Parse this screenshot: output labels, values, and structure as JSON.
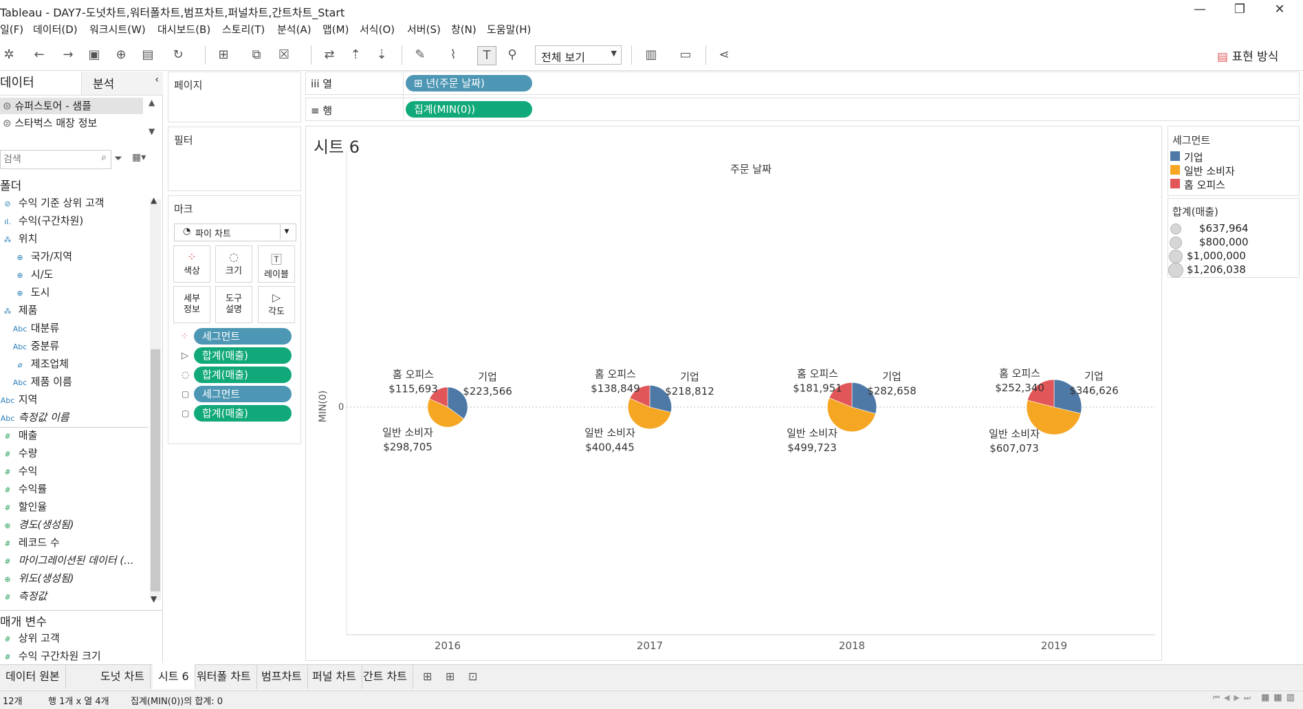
{
  "window": {
    "title": "Tableau - DAY7-도넛차트,워터폴차트,범프차트,퍼널차트,간트차트_Start"
  },
  "menu": [
    "일(F)",
    "데이터(D)",
    "워크시트(W)",
    "대시보드(B)",
    "스토리(T)",
    "분석(A)",
    "맵(M)",
    "서식(O)",
    "서버(S)",
    "창(N)",
    "도움말(H)"
  ],
  "toolbar": {
    "view_select": "전체 보기",
    "show_me": "표현 방식"
  },
  "datapane": {
    "tab_data": "데이터",
    "tab_analysis": "분석",
    "sources": [
      "슈퍼스토어 - 샘플",
      "스타벅스 매장 정보"
    ],
    "search_placeholder": "검색",
    "folder_header": "폴더",
    "fields": [
      {
        "label": "수익 기준 상위 고객",
        "icon": "set-icon"
      },
      {
        "label": "수익(구간차원)",
        "icon": "bin-icon"
      },
      {
        "label": "위치",
        "icon": "hierarchy-icon"
      },
      {
        "label": "국가/지역",
        "icon": "globe-icon"
      },
      {
        "label": "시/도",
        "icon": "globe-icon"
      },
      {
        "label": "도시",
        "icon": "globe-icon"
      },
      {
        "label": "제품",
        "icon": "hierarchy-icon"
      },
      {
        "label": "대분류",
        "icon": "abc-icon"
      },
      {
        "label": "중분류",
        "icon": "abc-icon"
      },
      {
        "label": "제조업체",
        "icon": "paperclip-icon"
      },
      {
        "label": "제품 이름",
        "icon": "abc-icon"
      },
      {
        "label": "지역",
        "icon": "abc-icon"
      },
      {
        "label": "측정값 이름",
        "icon": "abc-icon"
      },
      {
        "label": "매출",
        "icon": "measure-icon"
      },
      {
        "label": "수량",
        "icon": "measure-icon"
      },
      {
        "label": "수익",
        "icon": "measure-icon"
      },
      {
        "label": "수익률",
        "icon": "measure-icon"
      },
      {
        "label": "할인율",
        "icon": "measure-icon"
      },
      {
        "label": "경도(생성됨)",
        "icon": "globe-icon"
      },
      {
        "label": "레코드 수",
        "icon": "measure-icon"
      },
      {
        "label": "마이그레이션된 데이터 (...",
        "icon": "measure-icon"
      },
      {
        "label": "위도(생성됨)",
        "icon": "globe-icon"
      },
      {
        "label": "측정값",
        "icon": "measure-icon"
      }
    ],
    "params_header": "매개 변수",
    "params": [
      "상위 고객",
      "수익 구간차원 크기"
    ]
  },
  "shelves": {
    "pages": "페이지",
    "filters": "필터",
    "marks": "마크",
    "mark_type": "파이 차트",
    "mark_buttons": [
      "색상",
      "크기",
      "레이블",
      "세부\n정보",
      "도구\n설명",
      "각도"
    ],
    "mark_pills": [
      "세그먼트",
      "합계(매출)",
      "합계(매출)",
      "세그먼트",
      "합계(매출)"
    ],
    "columns_label": "열",
    "rows_label": "행",
    "columns_pill": "⊞ 년(주문 날짜)",
    "rows_pill": "집계(MIN(0))"
  },
  "legend": {
    "color_title": "세그먼트",
    "color_items": [
      {
        "label": "기업",
        "color": "#4e79a7"
      },
      {
        "label": "일반 소비자",
        "color": "#f5a623"
      },
      {
        "label": "홈 오피스",
        "color": "#e15759"
      }
    ],
    "size_title": "합계(매출)",
    "size_items": [
      "$637,964",
      "$800,000",
      "$1,000,000",
      "$1,206,038"
    ]
  },
  "chart_data": {
    "type": "pie",
    "title": "시트 6",
    "xlabel": "주문 날짜",
    "ylabel": "MIN(0)",
    "y_tick": "0",
    "categories": [
      "2016",
      "2017",
      "2018",
      "2019"
    ],
    "series": [
      {
        "name": "기업",
        "values": [
          223566,
          218812,
          282658,
          346626
        ],
        "labels": [
          "$223,566",
          "$218,812",
          "$282,658",
          "$346,626"
        ]
      },
      {
        "name": "일반 소비자",
        "values": [
          298705,
          400445,
          499723,
          607073
        ],
        "labels": [
          "$298,705",
          "$400,445",
          "$499,723",
          "$607,073"
        ]
      },
      {
        "name": "홈 오피스",
        "values": [
          115693,
          138849,
          181951,
          252340
        ],
        "labels": [
          "$115,693",
          "$138,849",
          "$181,951",
          "$252,340"
        ]
      }
    ]
  },
  "sheet_tabs": [
    "데이터 원본",
    "도넛 차트",
    "시트 6",
    "워터폴 차트",
    "범프차트",
    "퍼널 차트",
    "간트 차트"
  ],
  "active_tab": "시트 6",
  "status": {
    "marks": "12개",
    "dims": "행 1개 x 열 4개",
    "sum": "집계(MIN(0))의 합계: 0"
  }
}
